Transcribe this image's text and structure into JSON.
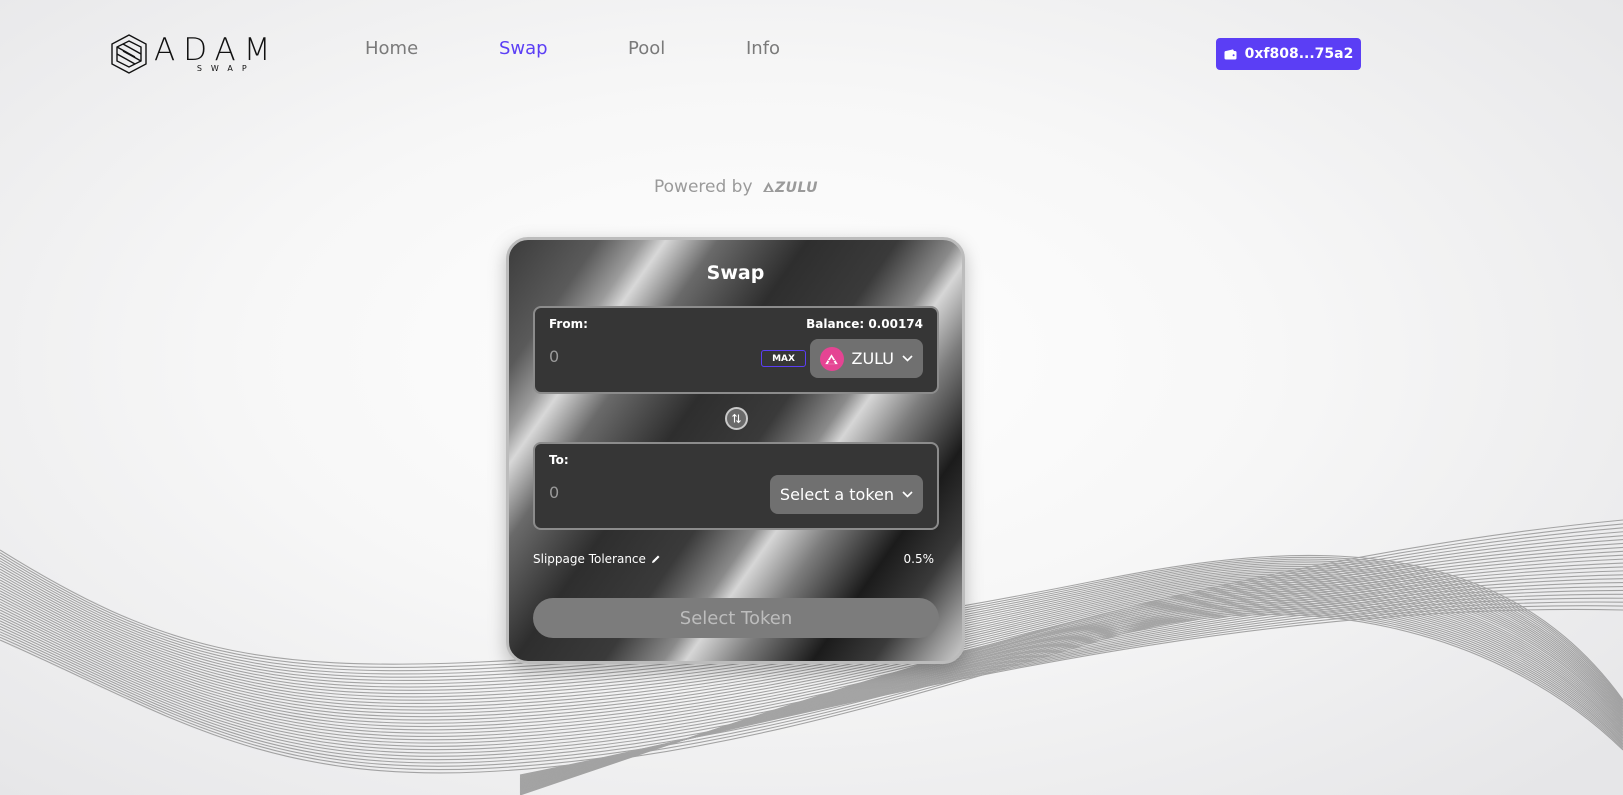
{
  "header": {
    "logo_text": "ADAM",
    "logo_sub": "SWAP",
    "nav": [
      {
        "label": "Home",
        "active": false
      },
      {
        "label": "Swap",
        "active": true
      },
      {
        "label": "Pool",
        "active": false
      },
      {
        "label": "Info",
        "active": false
      }
    ],
    "wallet_label": "0xf808...75a2",
    "wallet_icon": "wallet-icon"
  },
  "powered_by": {
    "prefix": "Powered by",
    "brand": "ZULU"
  },
  "swap": {
    "title": "Swap",
    "from": {
      "label": "From:",
      "balance": "Balance: 0.00174",
      "amount_placeholder": "0",
      "max_label": "MAX",
      "token_symbol": "ZULU"
    },
    "to": {
      "label": "To:",
      "amount_placeholder": "0",
      "token_button_label": "Select a token"
    },
    "slippage_label": "Slippage Tolerance",
    "slippage_value": "0.5%",
    "action_label": "Select Token"
  },
  "colors": {
    "accent": "#5b3ef5",
    "token_zulu": "#e54493"
  }
}
